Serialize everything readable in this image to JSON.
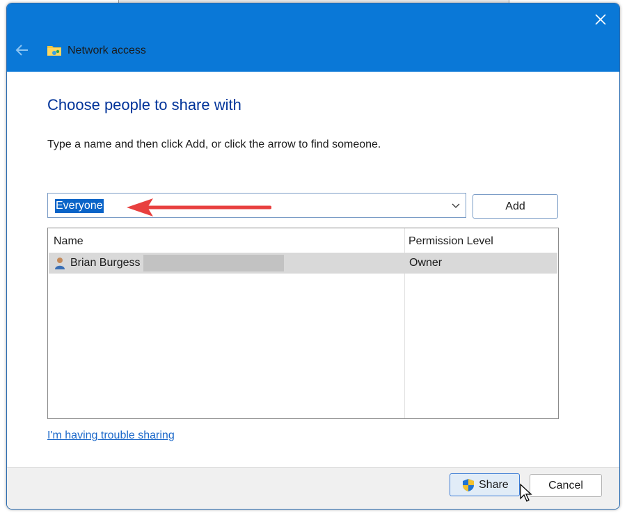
{
  "window": {
    "title": "Network access",
    "icons": {
      "back": "back-arrow-icon",
      "close": "close-icon",
      "app": "shared-folder-icon"
    }
  },
  "main": {
    "heading": "Choose people to share with",
    "instructions": "Type a name and then click Add, or click the arrow to find someone.",
    "name_input": {
      "value": "Everyone"
    },
    "add_label": "Add"
  },
  "list": {
    "columns": {
      "name": "Name",
      "permission": "Permission Level"
    },
    "rows": [
      {
        "name": "Brian Burgess",
        "permission": "Owner",
        "icon": "user-icon"
      }
    ]
  },
  "links": {
    "trouble": "I'm having trouble sharing"
  },
  "footer": {
    "share_label": "Share",
    "cancel_label": "Cancel"
  },
  "colors": {
    "titlebar": "#0a78d7",
    "heading": "#003399",
    "link": "#1a67c9",
    "selection": "#0a64c8",
    "annotation_arrow": "#e8403f",
    "row_selected": "#d9d9d9"
  }
}
